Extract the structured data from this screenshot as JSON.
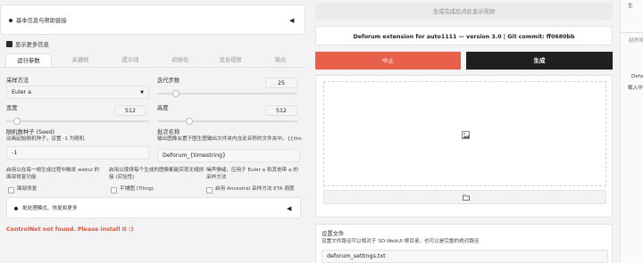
{
  "accordion_basic": {
    "label": "基本信息与帮助链接",
    "toggle_icon": "triangle-left-icon"
  },
  "show_more": {
    "label": "显示更多信息",
    "checked": true
  },
  "tabs": [
    {
      "label": "运行参数",
      "active": true
    },
    {
      "label": "关键帧",
      "active": false
    },
    {
      "label": "提示词",
      "active": false
    },
    {
      "label": "初始化",
      "active": false
    },
    {
      "label": "混合视频",
      "active": false
    },
    {
      "label": "输出",
      "active": false
    }
  ],
  "sampler": {
    "label": "采样方法",
    "value": "Euler a"
  },
  "steps": {
    "label": "迭代步数",
    "value": "25",
    "level": 0.17
  },
  "width": {
    "label": "宽度",
    "value": "512",
    "level": 0.35
  },
  "height": {
    "label": "高度",
    "value": "512",
    "level": 0.15
  },
  "seed": {
    "label": "随机数种子 (Seed)",
    "hint": "动画起始随机种子，设置 -1 为随机",
    "value": "-1"
  },
  "batch_name": {
    "label": "批次名称",
    "hint": "输出图像会置于图生图输出文件夹内含此名称的文件夹中。{{tim",
    "value": "Deforum_{timestring}"
  },
  "restore_faces": {
    "desc": "启用以在每一帧生成过程中触发 webui 的面部修复功能",
    "label": "面部修复"
  },
  "tiling": {
    "desc": "启用以使得每个生成的图像都能实现无缝拼接 (实验性)",
    "label": "平铺图 (Tiling)"
  },
  "ancestral_eta": {
    "desc": "噪声情绪，应用于 Euler a 和其他带 a 的采样方法",
    "label": "启用 Ancestral 采样方法 ETA 调度"
  },
  "accordion_batch": {
    "label": "批处理模式、恢复和更多",
    "toggle_icon": "triangle-left-icon"
  },
  "controlnet_msg": "ControlNet not found. Please install it :)",
  "top_hint": "生成完成后点此显示视频",
  "version_text": "Deforum extension for auto1111 — version 3.0 | Git commit: ff0680bb",
  "interrupt_label": "中止",
  "generate_label": "生成",
  "image_icon": "image-icon",
  "folder_icon": "folder-icon",
  "settings_file": {
    "label": "设置文件",
    "hint": "设置文件路径可以相对于 SD-WebUI 根目录，也可以是完整的绝对路径",
    "value": "deforum_settings.txt"
  },
  "right_edge": {
    "top": "生",
    "mid1": "越界限",
    "mid2": "Defa",
    "mid3": "载入中…"
  },
  "colors": {
    "accent": "#e8604c",
    "dark": "#1f1f1f",
    "error": "#e0533a"
  }
}
